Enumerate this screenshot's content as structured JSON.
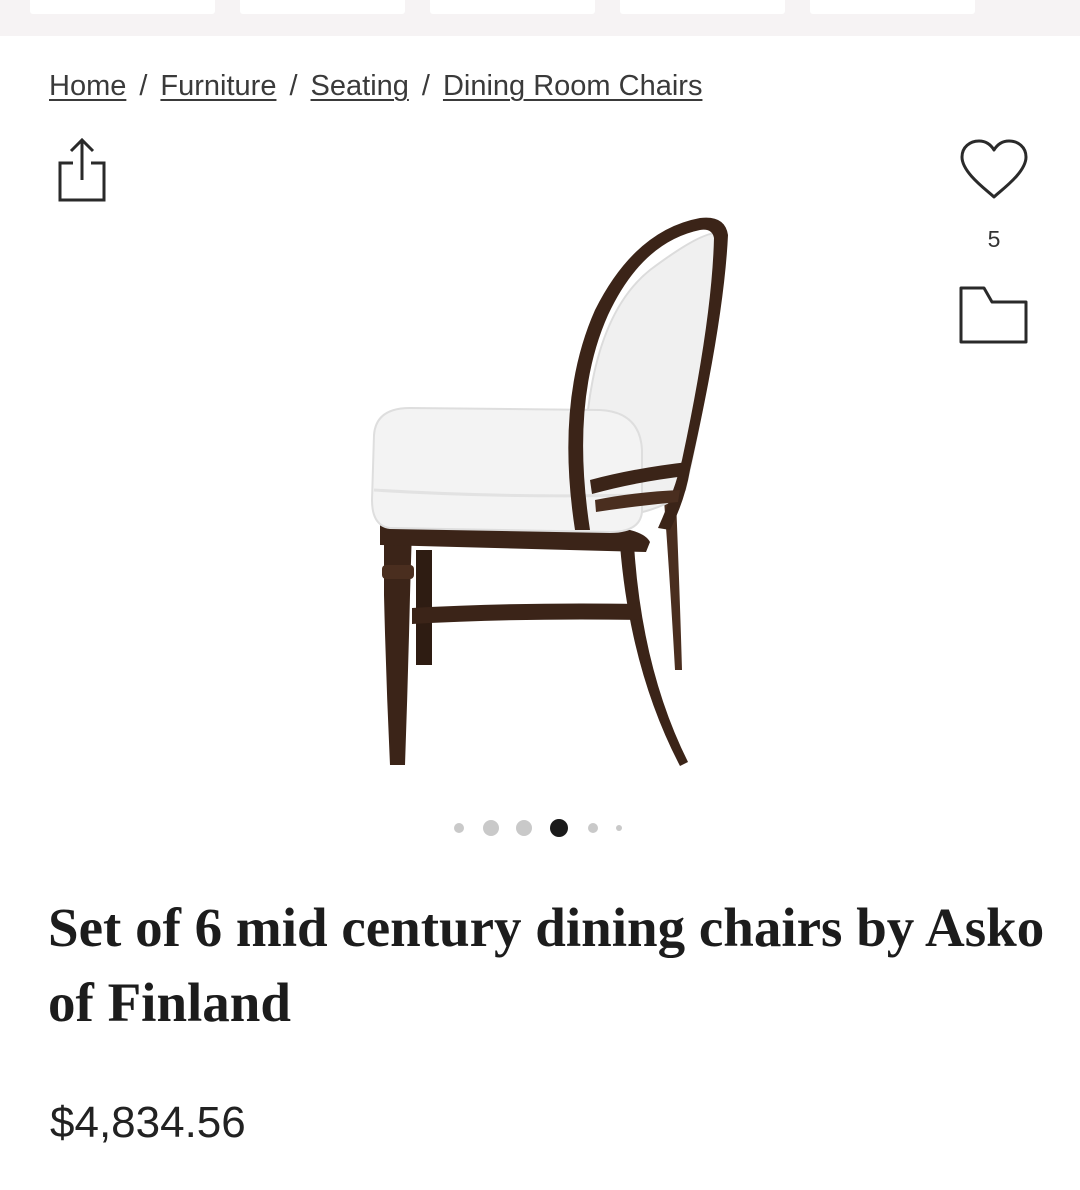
{
  "breadcrumb": {
    "items": [
      {
        "label": "Home"
      },
      {
        "label": "Furniture"
      },
      {
        "label": "Seating"
      },
      {
        "label": "Dining Room Chairs"
      }
    ],
    "separator": "/"
  },
  "actions": {
    "share_icon": "share-icon",
    "favorite_icon": "heart-icon",
    "favorite_count": "5",
    "save_icon": "folder-icon"
  },
  "gallery": {
    "image_count": 7,
    "active_index": 3
  },
  "product": {
    "title": "Set of 6 mid century dining chairs by Asko of Finland",
    "price": "$4,834.56"
  },
  "colors": {
    "wood": "#3b2418",
    "upholstery": "#f2f2f2",
    "text": "#222222",
    "active_dot": "#1a1a1a"
  }
}
